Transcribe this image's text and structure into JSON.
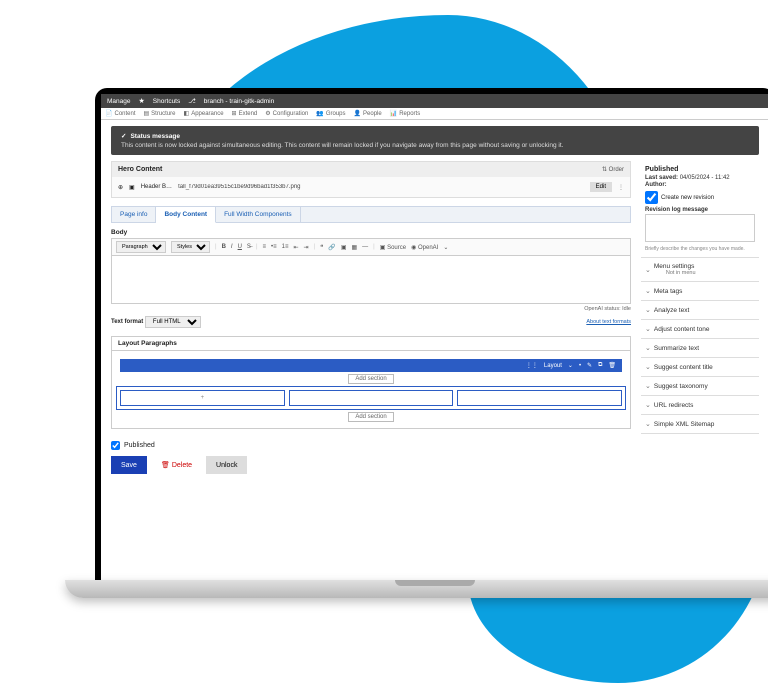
{
  "topbar": {
    "manage": "Manage",
    "shortcuts": "Shortcuts",
    "branch": "branch - train-gitk-admin"
  },
  "subbar": [
    "Content",
    "Structure",
    "Appearance",
    "Extend",
    "Configuration",
    "Groups",
    "People",
    "Reports"
  ],
  "status": {
    "title": "Status message",
    "body": "This content is now locked against simultaneous editing. This content will remain locked if you navigate away from this page without saving or unlocking it."
  },
  "hero": {
    "title": "Hero Content",
    "order": "Order",
    "item_label": "Header B…",
    "filename": "tall_f79d01ea39515c1be9d96bad1f353b7.png",
    "edit": "Edit"
  },
  "tabs": {
    "page_info": "Page info",
    "body_content": "Body Content",
    "full_width": "Full Width Components"
  },
  "body_label": "Body",
  "toolbar": {
    "paragraph": "Paragraph",
    "styles": "Styles",
    "source": "Source",
    "openai": "OpenAI"
  },
  "openai_status": "OpenAI status: Idle",
  "fmt": {
    "label": "Text format",
    "value": "Full HTML",
    "about": "About text formats"
  },
  "lp": {
    "title": "Layout Paragraphs",
    "layout": "Layout",
    "add": "Add section",
    "plus": "+"
  },
  "published_chk": "Published",
  "actions": {
    "save": "Save",
    "delete": "Delete",
    "unlock": "Unlock"
  },
  "side": {
    "published": "Published",
    "last_saved_l": "Last saved:",
    "last_saved_v": "04/05/2024 - 11:42",
    "author": "Author:",
    "revision_chk": "Create new revision",
    "revision_label": "Revision log message",
    "hint": "Briefly describe the changes you have made.",
    "menu": "Menu settings",
    "menu_sub": "Not in menu",
    "acc": [
      "Meta tags",
      "Analyze text",
      "Adjust content tone",
      "Summarize text",
      "Suggest content title",
      "Suggest taxonomy",
      "URL redirects",
      "Simple XML Sitemap"
    ]
  }
}
